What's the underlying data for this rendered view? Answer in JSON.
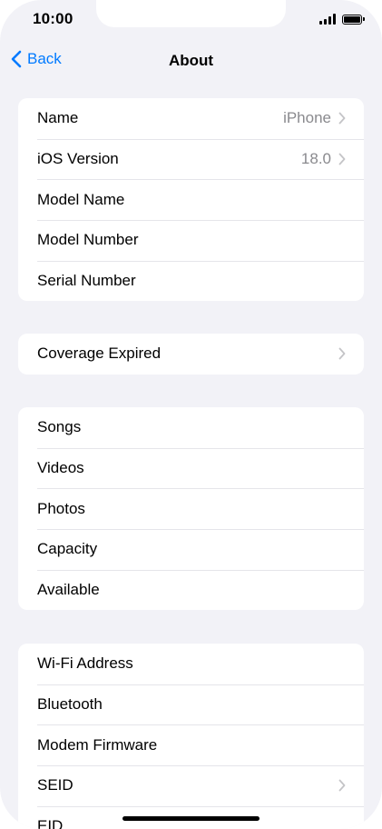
{
  "status_bar": {
    "time": "10:00"
  },
  "nav": {
    "back_label": "Back",
    "title": "About"
  },
  "groups": {
    "device": {
      "rows": [
        {
          "label": "Name",
          "value": "iPhone"
        },
        {
          "label": "iOS Version",
          "value": "18.0"
        },
        {
          "label": "Model Name"
        },
        {
          "label": "Model Number"
        },
        {
          "label": "Serial Number"
        }
      ]
    },
    "coverage": {
      "rows": [
        {
          "label": "Coverage Expired"
        }
      ]
    },
    "media": {
      "rows": [
        {
          "label": "Songs"
        },
        {
          "label": "Videos"
        },
        {
          "label": "Photos"
        },
        {
          "label": "Capacity"
        },
        {
          "label": "Available"
        }
      ]
    },
    "network": {
      "rows": [
        {
          "label": "Wi-Fi Address"
        },
        {
          "label": "Bluetooth"
        },
        {
          "label": "Modem Firmware"
        },
        {
          "label": "SEID"
        },
        {
          "label": "EID"
        }
      ]
    }
  },
  "colors": {
    "accent": "#007aff",
    "background": "#f2f2f7",
    "secondary_text": "#8a8a8e",
    "chevron": "#c4c4c7"
  }
}
